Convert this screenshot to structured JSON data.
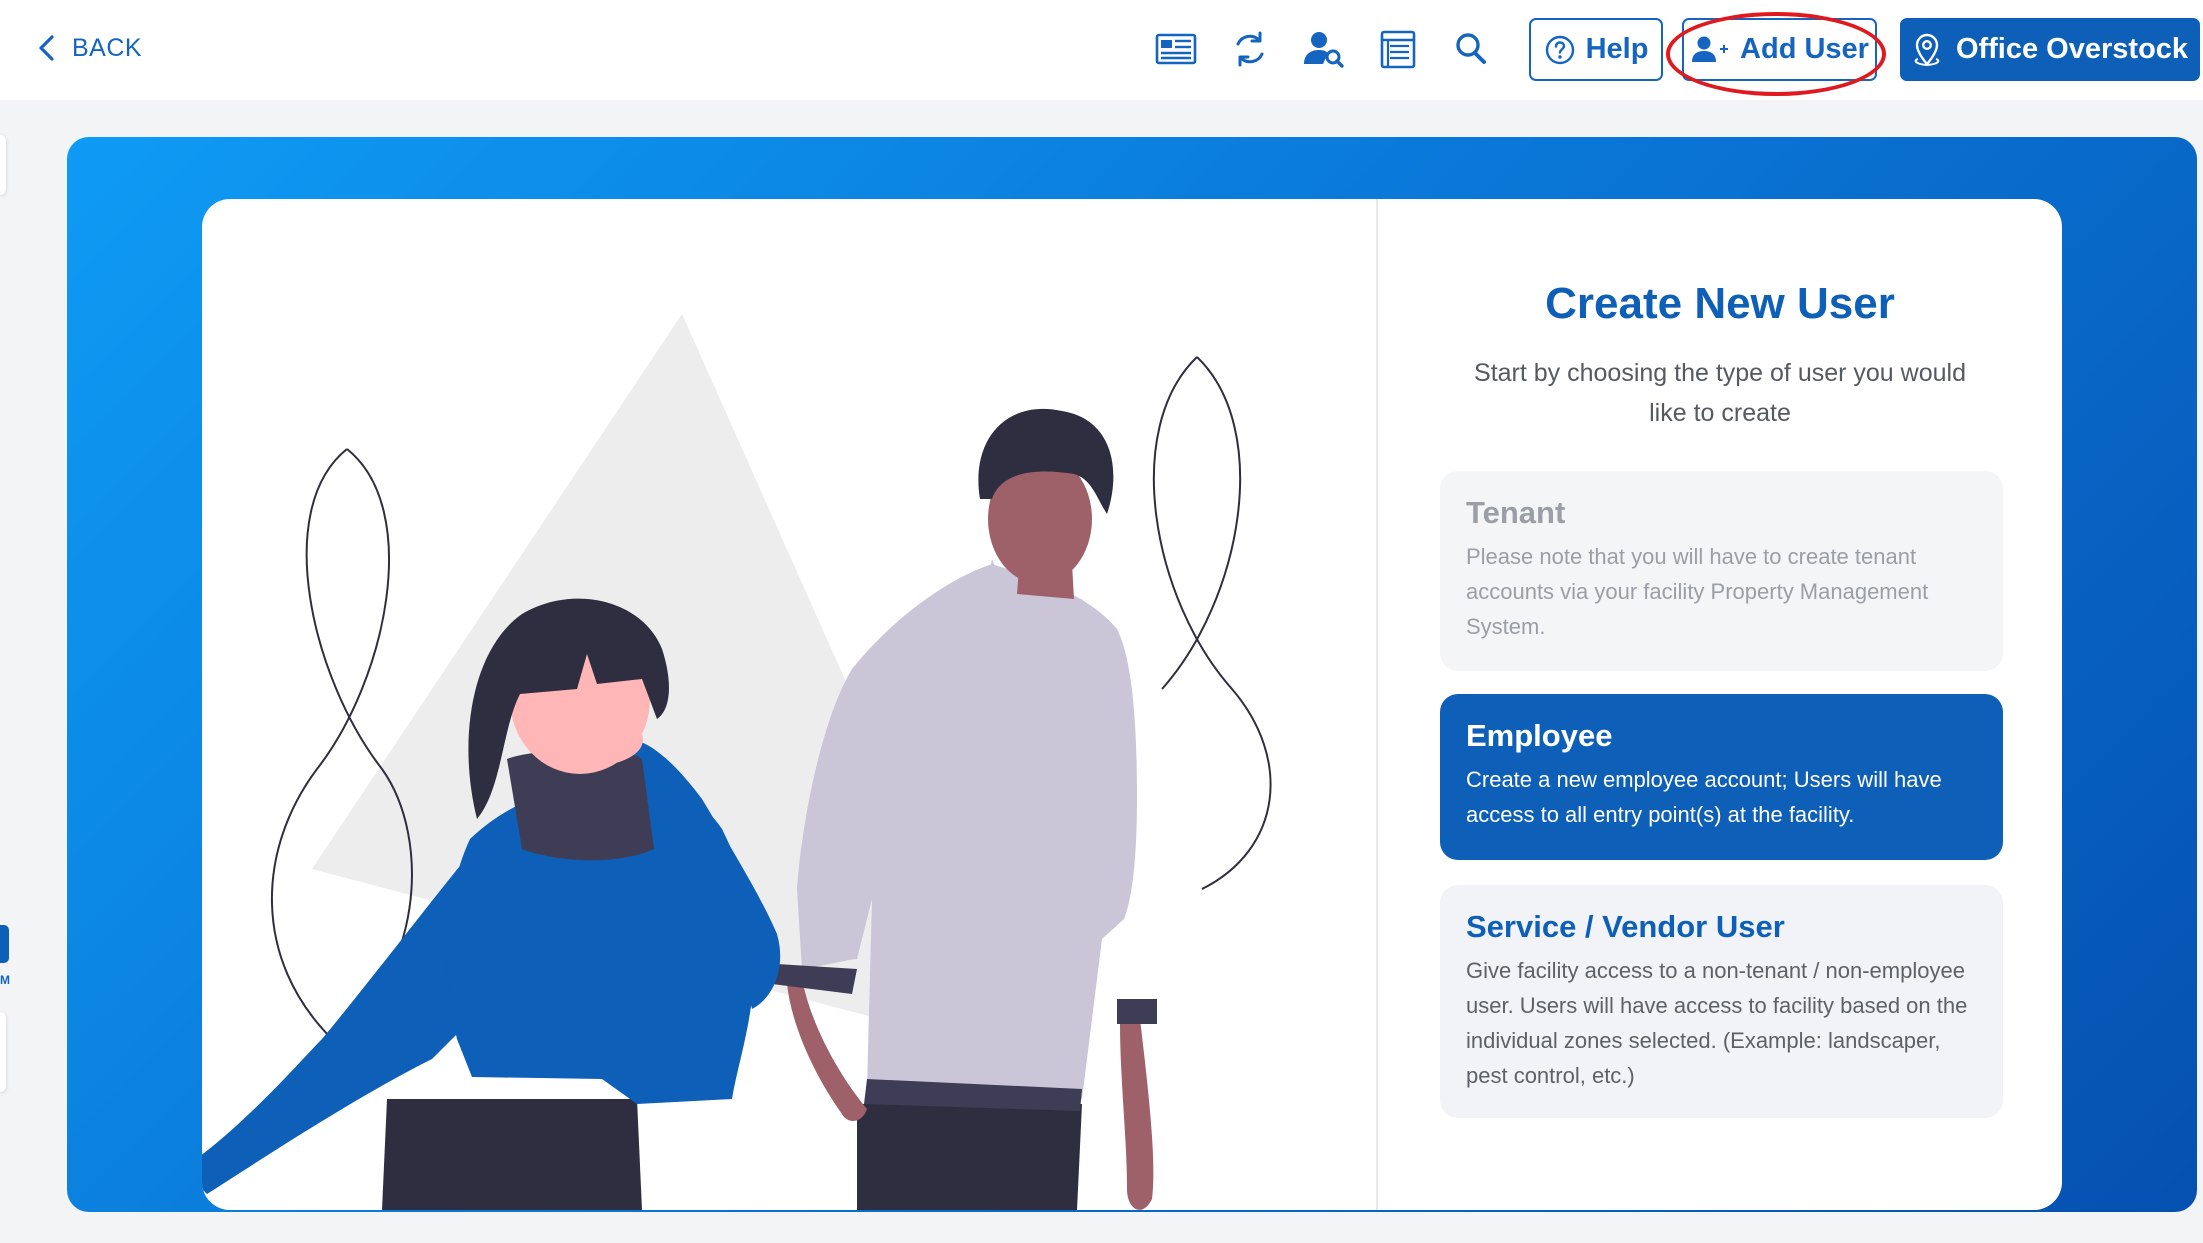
{
  "header": {
    "back_label": "BACK",
    "icons": [
      "newspaper-icon",
      "refresh-icon",
      "user-search-icon",
      "list-icon",
      "search-icon"
    ],
    "help_label": "Help",
    "add_user_label": "Add User",
    "facility_label": "Office Overstock"
  },
  "sidebar": {
    "collapsed_letter": "M"
  },
  "create_user": {
    "title": "Create New User",
    "subtitle": "Start by choosing the type of user you would like to create",
    "options": [
      {
        "title": "Tenant",
        "description": "Please note that you will have to create tenant accounts via your facility Property Management System.",
        "state": "disabled"
      },
      {
        "title": "Employee",
        "description": "Create a new employee account; Users will have access to all entry point(s) at the facility.",
        "state": "selected"
      },
      {
        "title": "Service / Vendor User",
        "description": "Give facility access to a non-tenant / non-employee user. Users will have access to facility based on the individual zones selected. (Example: landscaper, pest control, etc.)",
        "state": "default"
      }
    ]
  },
  "colors": {
    "accent": "#0d5fb8",
    "highlight_ring": "#e0191f",
    "hero_gradient_start": "#0e9bf5",
    "hero_gradient_end": "#0550b0"
  }
}
